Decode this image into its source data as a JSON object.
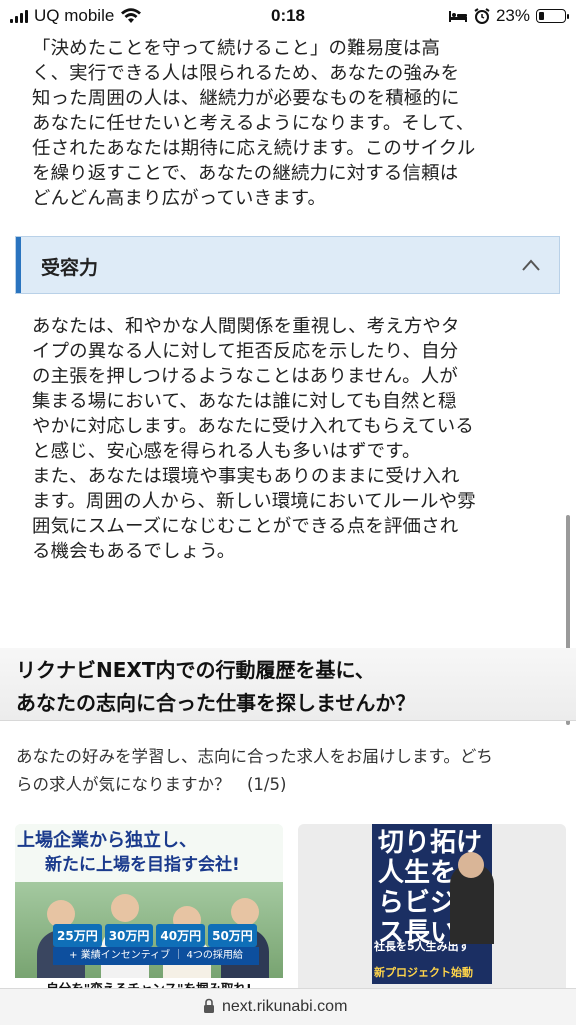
{
  "status_bar": {
    "carrier": "UQ mobile",
    "time": "0:18",
    "battery": "23%",
    "battery_level": 0.23
  },
  "intro_paragraph": "「決めたことを守って続けること」の難易度は高\nく、実行できる人は限られるため、あなたの強みを\n知った周囲の人は、継続力が必要なものを積極的に\nあなたに任せたいと考えるようになります。そして、\n任されたあなたは期待に応え続けます。このサイクル\nを繰り返すことで、あなたの継続力に対する信頼は\nどんどん高まり広がっていきます。",
  "accordion": {
    "title": "受容力",
    "body": "あなたは、和やかな人間関係を重視し、考え方やタ\nイプの異なる人に対して拒否反応を示したり、自分\nの主張を押しつけるようなことはありません。人が\n集まる場において、あなたは誰に対しても自然と穏\nやかに対応します。あなたに受け入れてもらえている\nと感じ、安心感を得られる人も多いはずです。\nまた、あなたは環境や事実もありのままに受け入れ\nます。周囲の人から、新しい環境においてルールや雰\n囲気にスムーズになじむことができる点を評価され\nる機会もあるでしょう。"
  },
  "promo": {
    "line1": "リクナビNEXT内での行動履歴を基に、",
    "line2": "あなたの志向に合った仕事を探しませんか？",
    "description": "あなたの好みを学習し、志向に合った求人をお届けします。どち\nらの求人が気になりますか？　(1/5)"
  },
  "cards": [
    {
      "headline1": "上場企業から独立し、",
      "headline2": "新たに上場を目指す会社!",
      "salaries": [
        "25万円",
        "30万円",
        "40万円",
        "50万円"
      ],
      "badge": "+ 業績インセンティブ ｜ 4つの採用給",
      "tagline": "自分を\"変えるチャンス\"を掴み取れ!"
    },
    {
      "headline": "切り拓け人生を自らビジネス長い",
      "subline": "社長を5人生み出す",
      "subline2": "新プロジェクト始動"
    }
  ],
  "url_bar": {
    "domain": "next.rikunabi.com"
  },
  "colors": {
    "accent_blue": "#2a74bf",
    "accordion_bg": "#deebf7"
  }
}
